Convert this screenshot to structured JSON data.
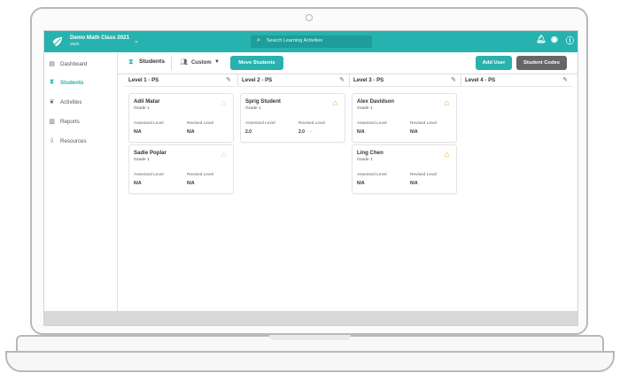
{
  "app": {
    "class_title": "Demo Math Class 2021",
    "class_subtitle": "Math",
    "search_placeholder": "Search Learning Activities"
  },
  "icons": {
    "logo": "leaf-logo-icon",
    "search": "search-icon",
    "notifications": "bell-icon",
    "account": "user-icon",
    "info": "info-icon",
    "edit": "edit-icon",
    "home": "home-icon"
  },
  "sidebar": {
    "items": [
      {
        "label": "Dashboard",
        "icon": "clipboard-icon",
        "active": false
      },
      {
        "label": "Students",
        "icon": "students-icon",
        "active": true
      },
      {
        "label": "Activities",
        "icon": "activities-icon",
        "active": false
      },
      {
        "label": "Reports",
        "icon": "reports-icon",
        "active": false
      },
      {
        "label": "Resources",
        "icon": "download-icon",
        "active": false
      }
    ]
  },
  "toolbar": {
    "students_label": "Students",
    "custom_label": "Custom",
    "move_students_label": "Move Students",
    "add_user_label": "Add User",
    "student_codes_label": "Student Codes"
  },
  "columns": [
    {
      "title": "Level 1 - PS"
    },
    {
      "title": "Level 2 - PS"
    },
    {
      "title": "Level 3 - PS"
    },
    {
      "title": "Level 4 - PS"
    }
  ],
  "cards": [
    {
      "name": "Adil Matar",
      "grade": "Grade 1",
      "assessed_label": "Assessed Level",
      "revised_label": "Revised Level",
      "assessed": "N/A",
      "revised": "N/A",
      "home": "gray"
    },
    {
      "name": "Sadie Poplar",
      "grade": "Grade 1",
      "assessed_label": "Assessed Level",
      "revised_label": "Revised Level",
      "assessed": "N/A",
      "revised": "N/A",
      "home": "gray"
    },
    {
      "name": "Sprig Student",
      "grade": "Grade 1",
      "assessed_label": "Assessed Level",
      "revised_label": "Revised Level",
      "assessed": "2.0",
      "revised": "2.0",
      "trend": "→",
      "home": "orange"
    },
    {
      "name": "Alex Davidson",
      "grade": "Grade 1",
      "assessed_label": "Assessed Level",
      "revised_label": "Revised Level",
      "assessed": "N/A",
      "revised": "N/A",
      "home": "orange"
    },
    {
      "name": "Ling Chen",
      "grade": "Grade 1",
      "assessed_label": "Assessed Level",
      "revised_label": "Revised Level",
      "assessed": "N/A",
      "revised": "N/A",
      "home": "orange"
    }
  ],
  "colors": {
    "accent": "#2ab1ae",
    "topbar": "#26b3b0",
    "muted_button": "#666666",
    "warning": "#f59a13"
  }
}
